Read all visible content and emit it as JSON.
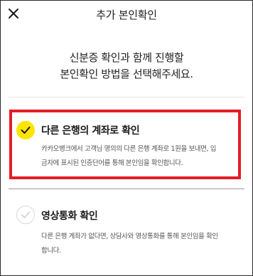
{
  "header": {
    "title": "추가 본인확인",
    "close_icon": "close-icon"
  },
  "intro": {
    "line1": "신분증 확인과 함께 진행할",
    "line2": "본인확인 방법을 선택해주세요."
  },
  "options": [
    {
      "title": "다른 은행의 계좌로 확인",
      "desc_line1": "카카오뱅크에서 고객님 명의의 다른 은행 계좌로 1원을 보내면, 입",
      "desc_line2": "금자에 표시된 인증단어를 통해 본인임을 확인합니다.",
      "selected": true
    },
    {
      "title": "영상통화 확인",
      "desc_line1": "다른 은행 계좌가 없다면, 상담사와 영상통화를 통해 본인임을 확인",
      "desc_line2": "합니다.",
      "selected": false
    }
  ],
  "colors": {
    "accent_yellow": "#fee500",
    "highlight_red": "#e41e26"
  }
}
